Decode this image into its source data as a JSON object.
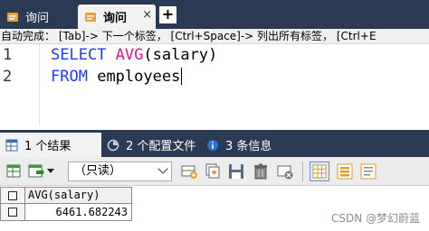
{
  "query_tabs": [
    {
      "label": "询问",
      "icon": "query-icon",
      "active": false
    },
    {
      "label": "询问",
      "icon": "query-icon",
      "active": true,
      "close": "×"
    }
  ],
  "new_tab_label": "+",
  "autocomplete_hint": "自动完成：  [Tab]-> 下一个标签， [Ctrl+Space]-> 列出所有标签， [Ctrl+E",
  "editor": {
    "line_numbers": [
      "1",
      "2"
    ],
    "line1": {
      "keyword": "SELECT",
      "func": "AVG",
      "args": "(salary)"
    },
    "line2": {
      "keyword": "FROM",
      "table": "employees"
    }
  },
  "result_tabs": [
    {
      "label": "1 个结果",
      "icon": "grid-icon",
      "active": true
    },
    {
      "label": "2 个配置文件",
      "icon": "profile-icon",
      "active": false
    },
    {
      "label": "3 条信息",
      "icon": "info-icon",
      "active": false
    }
  ],
  "toolbar": {
    "mode_select": "（只读）"
  },
  "result_grid": {
    "columns": [
      "AVG(salary)"
    ],
    "rows": [
      [
        "6461.682243"
      ]
    ]
  },
  "watermark": "CSDN @梦幻蔚蓝",
  "colors": {
    "tab_bar": "#2a3a52",
    "keyword": "#1f3cff",
    "function": "#e0188a"
  }
}
